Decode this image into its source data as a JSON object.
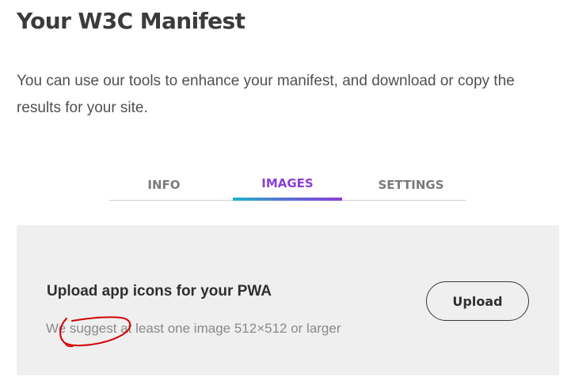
{
  "header": {
    "title": "Your W3C Manifest",
    "description": "You can use our tools to enhance your manifest, and download or copy the results for your site."
  },
  "tabs": [
    {
      "label": "INFO",
      "active": false
    },
    {
      "label": "IMAGES",
      "active": true
    },
    {
      "label": "SETTINGS",
      "active": false
    }
  ],
  "upload": {
    "heading": "Upload app icons for your PWA",
    "hint": "We suggest at least one image 512×512 or larger",
    "button_label": "Upload"
  },
  "colors": {
    "active_tab": "#8a3fd8",
    "tab_gradient_start": "#1fb1c9",
    "tab_gradient_end": "#8a3fd8",
    "annotation": "#d40000"
  }
}
